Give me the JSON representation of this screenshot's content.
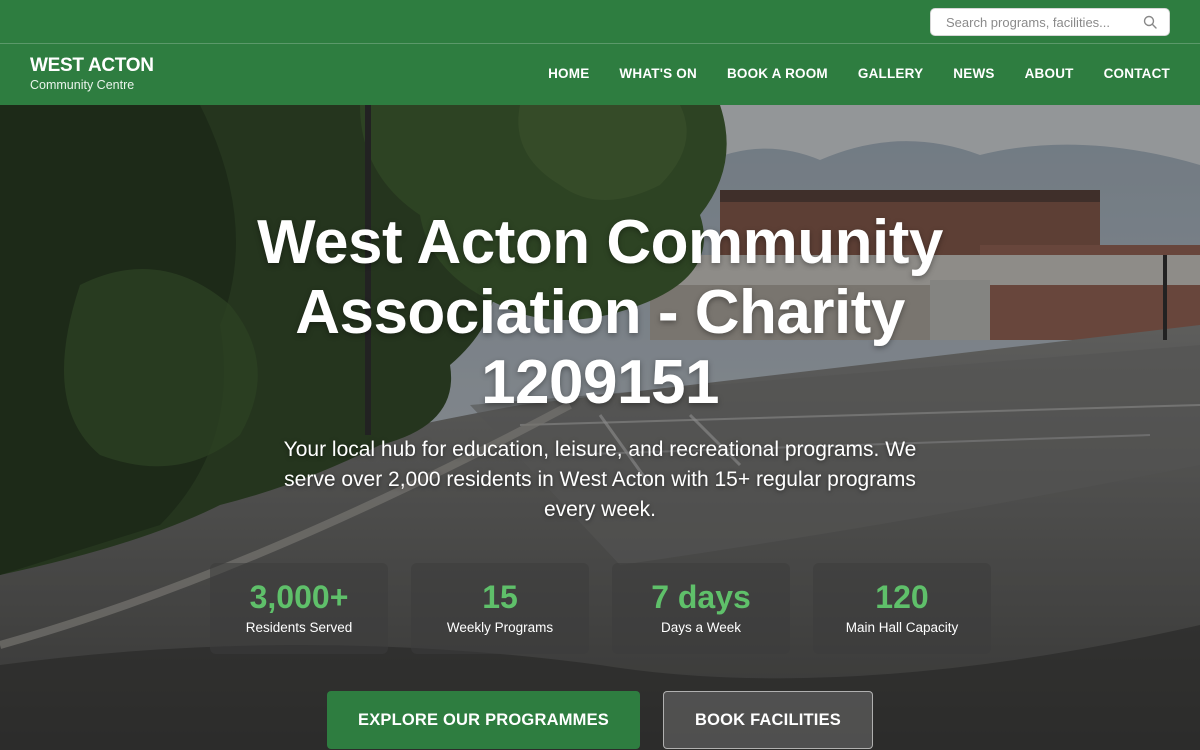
{
  "header": {
    "search": {
      "placeholder": "Search programs, facilities..."
    },
    "logo": {
      "name": "WEST ACTON",
      "subtitle": "Community Centre"
    },
    "nav": [
      {
        "label": "HOME"
      },
      {
        "label": "WHAT'S ON"
      },
      {
        "label": "BOOK A ROOM"
      },
      {
        "label": "GALLERY"
      },
      {
        "label": "NEWS"
      },
      {
        "label": "ABOUT"
      },
      {
        "label": "CONTACT"
      }
    ]
  },
  "hero": {
    "title_lines": [
      "West Acton Community",
      "Association - Charity",
      "1209151"
    ],
    "subtitle_lines": [
      "Your local hub for education, leisure, and recreational programs. We",
      "serve over 2,000 residents in West Acton with 15+ regular programs",
      "every week."
    ],
    "stats": [
      {
        "value": "3,000+",
        "label": "Residents Served"
      },
      {
        "value": "15",
        "label": "Weekly Programs"
      },
      {
        "value": "7 days",
        "label": "Days a Week"
      },
      {
        "value": "120",
        "label": "Main Hall Capacity"
      }
    ],
    "primary_button": "EXPLORE OUR PROGRAMMES",
    "secondary_button": "BOOK FACILITIES"
  },
  "colors": {
    "brand_green": "#2e7d40",
    "stat_green": "#5fc06a",
    "text_white": "#ffffff"
  },
  "icons": {
    "search": "search-icon"
  }
}
